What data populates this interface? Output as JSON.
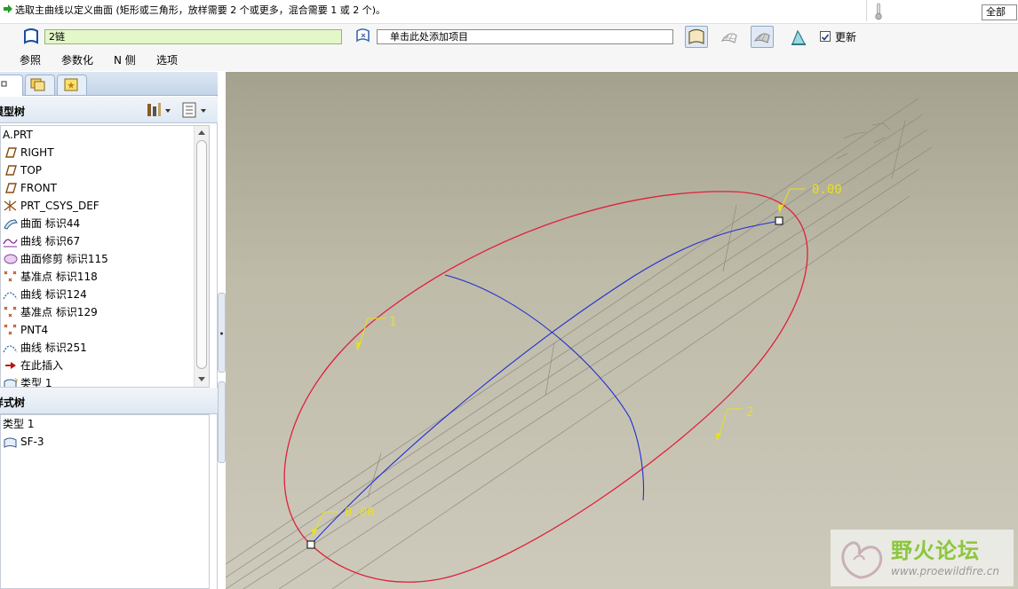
{
  "message": {
    "text": "选取主曲线以定义曲面 (矩形或三角形，放样需要 2 个或更多，混合需要 1 或 2 个)。"
  },
  "filter": {
    "value": "全部"
  },
  "dashboard": {
    "chain_field": "2链",
    "add_field": "单击此处添加项目",
    "update_label": "更新",
    "update_checked": true,
    "tabs": [
      "参照",
      "参数化",
      "N 侧",
      "选项"
    ]
  },
  "left_panel": {
    "model_tree_title": "模型树",
    "model_tree_items": [
      {
        "label": "A.PRT",
        "icon": "part-icon"
      },
      {
        "label": "RIGHT",
        "icon": "datum-plane-icon"
      },
      {
        "label": "TOP",
        "icon": "datum-plane-icon"
      },
      {
        "label": "FRONT",
        "icon": "datum-plane-icon"
      },
      {
        "label": "PRT_CSYS_DEF",
        "icon": "csys-icon"
      },
      {
        "label": "曲面 标识44",
        "icon": "surface-icon"
      },
      {
        "label": "曲线 标识67",
        "icon": "curve-icon"
      },
      {
        "label": "曲面修剪 标识115",
        "icon": "trim-icon"
      },
      {
        "label": "基准点 标识118",
        "icon": "datum-point-icon"
      },
      {
        "label": "曲线 标识124",
        "icon": "curve-dotted-icon"
      },
      {
        "label": "基准点 标识129",
        "icon": "datum-point-icon"
      },
      {
        "label": "PNT4",
        "icon": "datum-point-icon"
      },
      {
        "label": "曲线 标识251",
        "icon": "curve-dotted-icon"
      },
      {
        "label": "在此插入",
        "icon": "insert-arrow-icon"
      },
      {
        "label": "类型 1",
        "icon": "style-surface-icon"
      }
    ],
    "style_tree_title": "样式树",
    "style_tree_items": [
      {
        "label": "类型 1"
      },
      {
        "label": "SF-3"
      }
    ]
  },
  "viewport": {
    "annotations": [
      "0.00",
      "0.00",
      "1",
      "2"
    ]
  },
  "watermark": {
    "title": "野火论坛",
    "url": "www.proewildfire.cn"
  },
  "colors": {
    "boundary_curve": "#e0203a",
    "internal_curve": "#2030d0",
    "annotation": "#e8e020",
    "chain_field_bg": "#e3f7c8"
  }
}
